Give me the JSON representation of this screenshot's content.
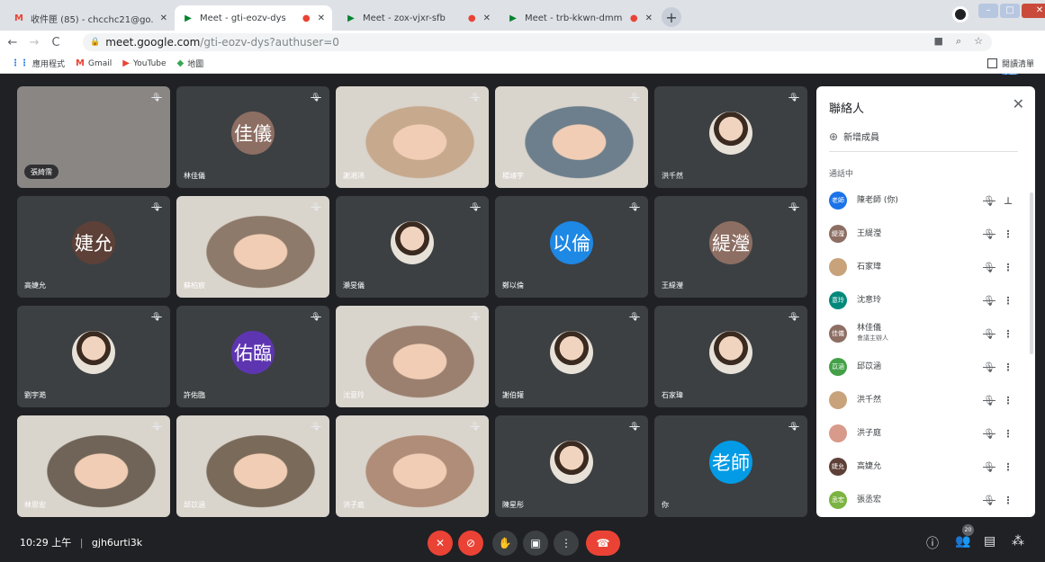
{
  "tabs": [
    {
      "favicon": "M",
      "title": "收件匣 (85) - chcchc21@go.edu.tw",
      "active": false
    },
    {
      "favicon": "▶",
      "title": "Meet - gti-eozv-dys",
      "active": true
    },
    {
      "favicon": "▶",
      "title": "Meet - zox-vjxr-sfb",
      "active": false
    },
    {
      "favicon": "▶",
      "title": "Meet - trb-kkwn-dmm",
      "active": false
    }
  ],
  "address": {
    "host": "meet.google.com",
    "path": "/gti-eozv-dys?authuser=0"
  },
  "account_initials": "老師",
  "bookmarks": [
    {
      "icon": "apps-icon",
      "label": "應用程式"
    },
    {
      "icon": "gmail-icon",
      "label": "Gmail"
    },
    {
      "icon": "youtube-icon",
      "label": "YouTube"
    },
    {
      "icon": "maps-icon",
      "label": "地圖"
    }
  ],
  "reading_list": "閱讀清單",
  "tiles": [
    {
      "name": "張綺霈",
      "kind": "pill"
    },
    {
      "name": "林佳儀",
      "kind": "avatar",
      "initials": "佳儀",
      "color": "#8d6e63"
    },
    {
      "name": "謝湘沛",
      "kind": "video"
    },
    {
      "name": "楊靖宇",
      "kind": "video"
    },
    {
      "name": "洪千然",
      "kind": "photo"
    },
    {
      "name": "高婕允",
      "kind": "avatar",
      "initials": "婕允",
      "color": "#5d4037"
    },
    {
      "name": "蘇柏宸",
      "kind": "video"
    },
    {
      "name": "瀨旻儀",
      "kind": "photo"
    },
    {
      "name": "鄭以倫",
      "kind": "avatar",
      "initials": "以倫",
      "color": "#1e88e5"
    },
    {
      "name": "王緹瀅",
      "kind": "avatar",
      "initials": "緹瀅",
      "color": "#8d6e63"
    },
    {
      "name": "劉宇澔",
      "kind": "photo"
    },
    {
      "name": "許佑臨",
      "kind": "avatar",
      "initials": "佑臨",
      "color": "#5e35b1"
    },
    {
      "name": "沈意玲",
      "kind": "video"
    },
    {
      "name": "謝伯鑵",
      "kind": "photo"
    },
    {
      "name": "石家瑋",
      "kind": "photo"
    },
    {
      "name": "林思宏",
      "kind": "video"
    },
    {
      "name": "邱苡涵",
      "kind": "video"
    },
    {
      "name": "洪子庭",
      "kind": "video"
    },
    {
      "name": "陳星彤",
      "kind": "photo"
    },
    {
      "name": "你",
      "kind": "avatar",
      "initials": "老師",
      "color": "#039be5"
    }
  ],
  "panel": {
    "title": "聯絡人",
    "add_label": "新增成員",
    "section": "通話中",
    "people": [
      {
        "name": "陳老師 (你)",
        "initials": "老師",
        "color": "#1a73e8",
        "sub": "",
        "pin": true
      },
      {
        "name": "王緹瀅",
        "initials": "緹瀅",
        "color": "#8d6e63",
        "sub": ""
      },
      {
        "name": "石家瑋",
        "initials": "",
        "color": "#c8a27a",
        "sub": ""
      },
      {
        "name": "沈意玲",
        "initials": "意玲",
        "color": "#00897b",
        "sub": ""
      },
      {
        "name": "林佳儀",
        "initials": "佳儀",
        "color": "#8d6e63",
        "sub": "會議主辦人"
      },
      {
        "name": "邱苡涵",
        "initials": "苡涵",
        "color": "#43a047",
        "sub": ""
      },
      {
        "name": "洪千然",
        "initials": "",
        "color": "#c8a27a",
        "sub": ""
      },
      {
        "name": "洪子庭",
        "initials": "",
        "color": "#d89a8a",
        "sub": ""
      },
      {
        "name": "高婕允",
        "initials": "婕允",
        "color": "#5d4037",
        "sub": ""
      },
      {
        "name": "張丞宏",
        "initials": "丞宏",
        "color": "#7cb342",
        "sub": ""
      }
    ]
  },
  "meeting": {
    "time": "10:29 上午",
    "code": "gjh6urti3k"
  },
  "participant_count": "20",
  "colors": {
    "end_call": "#ea4335",
    "bg": "#202124",
    "tile": "#3c4043"
  }
}
